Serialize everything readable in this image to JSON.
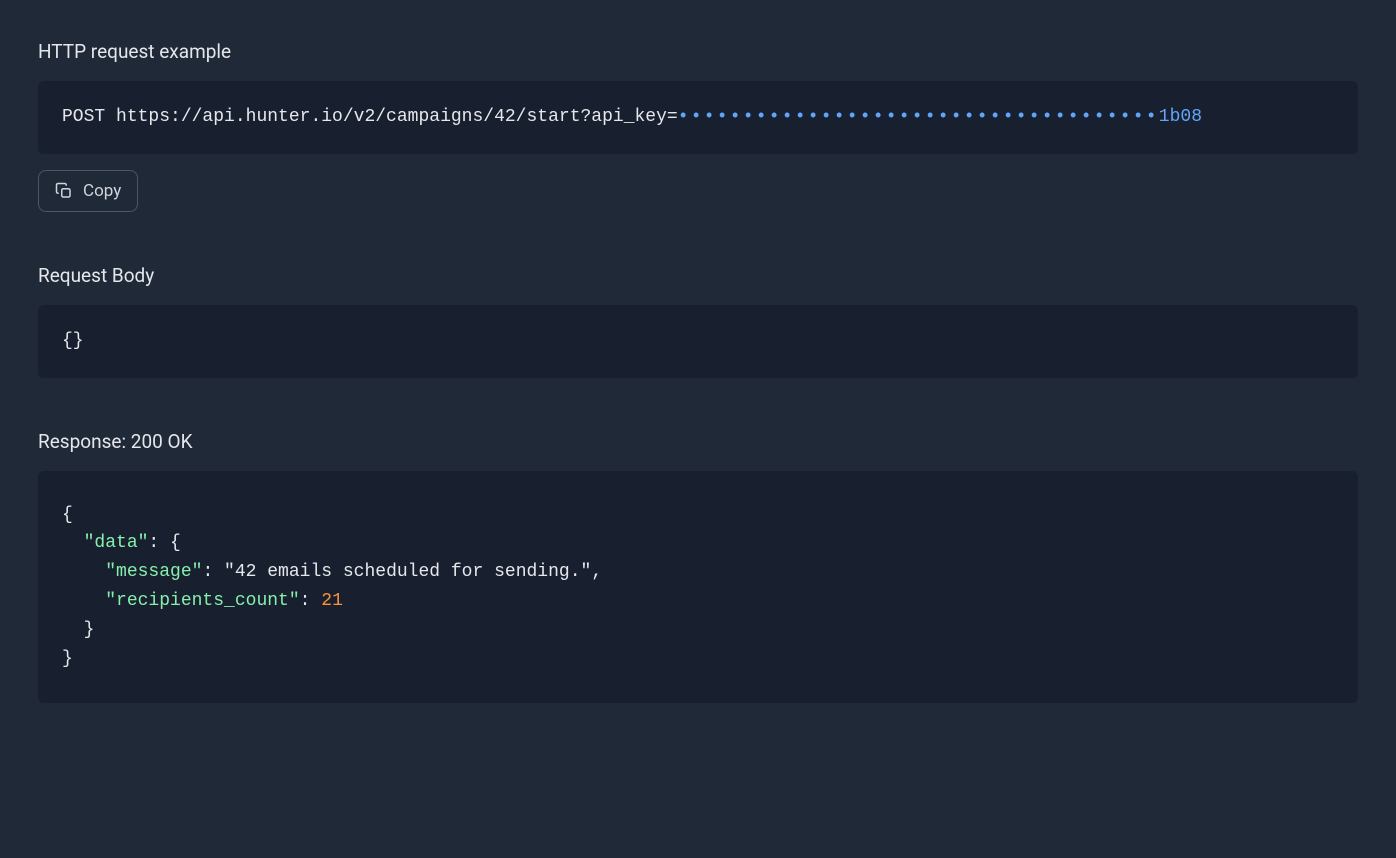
{
  "httpRequest": {
    "title": "HTTP request example",
    "method": "POST ",
    "url": "https://api.hunter.io/v2/campaigns/42/start?api_key=",
    "apiKeyDots": "•••••••••••••••••••••••••••••••••••••",
    "apiKeySuffix": "1b08",
    "copyLabel": "Copy"
  },
  "requestBody": {
    "title": "Request Body",
    "content": "{}"
  },
  "response": {
    "title": "Response: 200 OK",
    "json": {
      "open": "{",
      "dataKey": "\"data\"",
      "dataColon": ": {",
      "messageKey": "\"message\"",
      "messageColon": ": ",
      "messageValue": "\"42 emails scheduled for sending.\"",
      "messageComma": ",",
      "recipientsKey": "\"recipients_count\"",
      "recipientsColon": ": ",
      "recipientsValue": "21",
      "close2": "}",
      "close1": "}"
    }
  }
}
